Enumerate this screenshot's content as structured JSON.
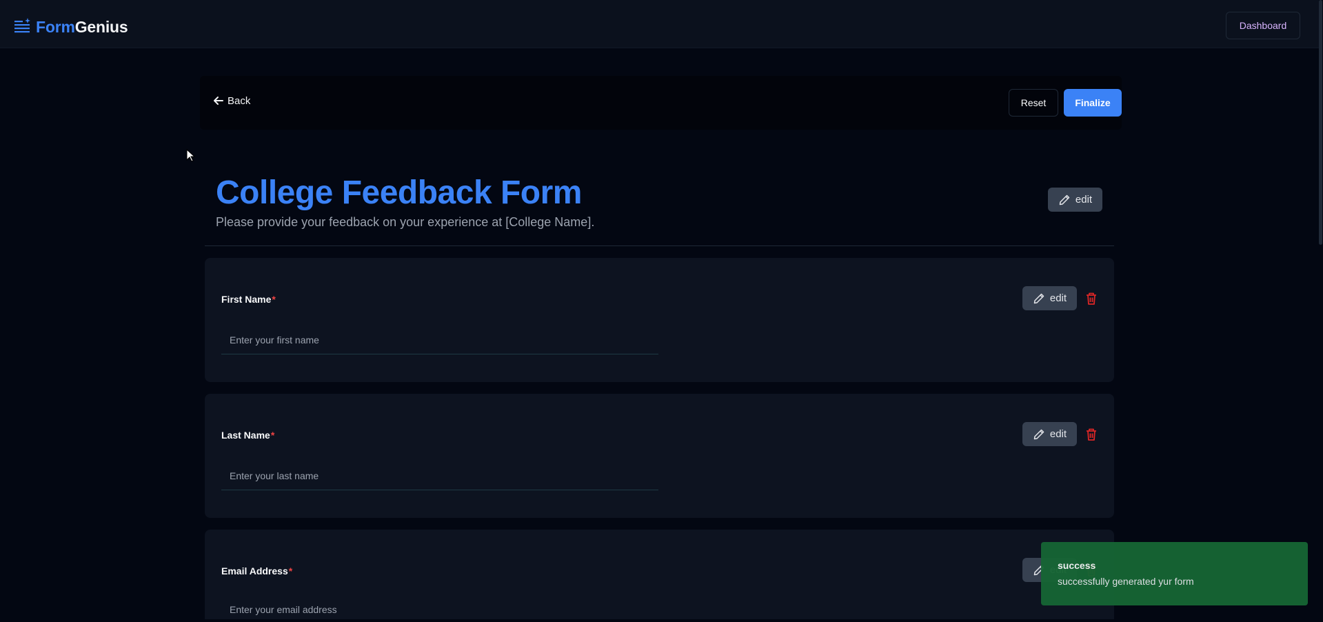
{
  "app": {
    "brand_first": "Form",
    "brand_second": "Genius",
    "dashboard_label": "Dashboard"
  },
  "actions": {
    "back_label": "Back",
    "reset_label": "Reset",
    "finalize_label": "Finalize"
  },
  "form": {
    "title": "College Feedback Form",
    "description": "Please provide your feedback on your experience at [College Name].",
    "edit_label": "edit"
  },
  "fields": [
    {
      "label": "First Name",
      "required_mark": "*",
      "placeholder": "Enter your first name",
      "edit_label": "edit"
    },
    {
      "label": "Last Name",
      "required_mark": "*",
      "placeholder": "Enter your last name",
      "edit_label": "edit"
    },
    {
      "label": "Email Address",
      "required_mark": "*",
      "placeholder": "Enter your email address",
      "edit_label": "edit"
    }
  ],
  "toast": {
    "title": "success",
    "message": "successfully generated yur form"
  },
  "colors": {
    "accent": "#3b82f6",
    "background": "#030712",
    "card": "#0d1320",
    "required": "#ef4444",
    "delete": "#dc2626",
    "toast": "#166534"
  },
  "icons": {
    "brand": "list-sparkle-icon",
    "back": "arrow-left-icon",
    "edit": "pencil-icon",
    "delete": "trash-icon",
    "cursor": "mouse-pointer-icon"
  }
}
